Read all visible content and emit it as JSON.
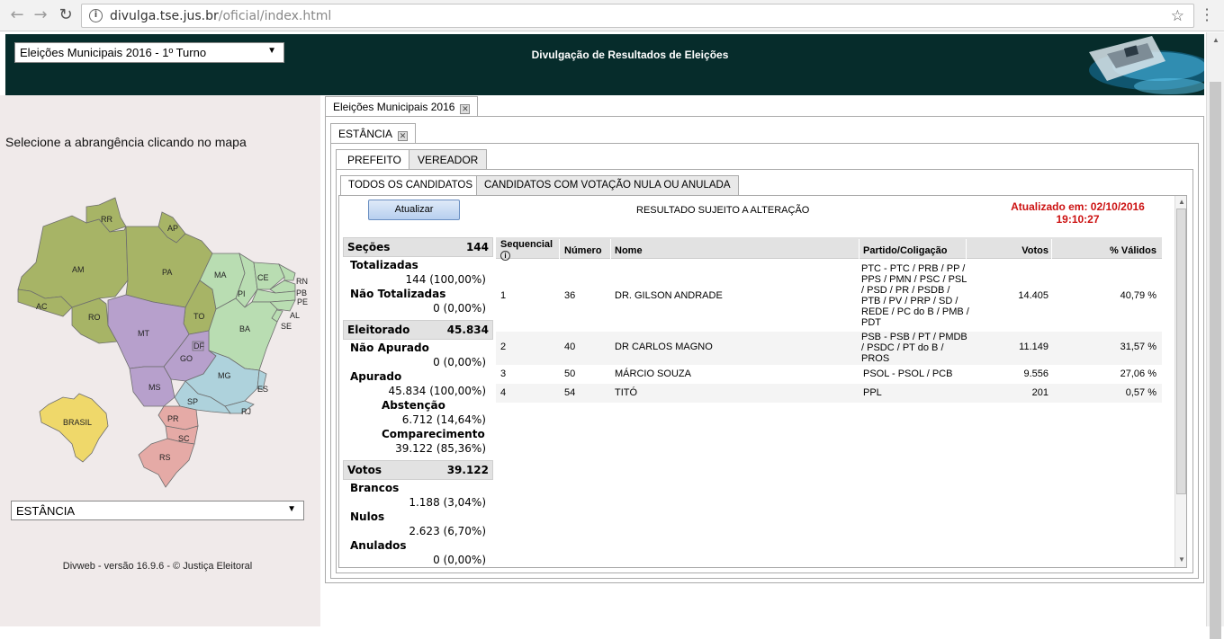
{
  "browser": {
    "url_host": "divulga.tse.jus.br",
    "url_path": "/oficial/index.html"
  },
  "header": {
    "election_select": "Eleições Municipais 2016 - 1º Turno",
    "title": "Divulgação de Resultados de Eleições"
  },
  "left": {
    "prompt": "Selecione a abrangência clicando no mapa",
    "map_labels": [
      "RR",
      "AP",
      "AM",
      "PA",
      "MA",
      "CE",
      "RN",
      "PB",
      "PE",
      "AL",
      "SE",
      "PI",
      "AC",
      "RO",
      "TO",
      "BA",
      "MT",
      "DF",
      "GO",
      "MG",
      "ES",
      "MS",
      "SP",
      "RJ",
      "PR",
      "SC",
      "RS",
      "BRASIL"
    ],
    "city_select": "ESTÂNCIA",
    "footer": "Divweb - versão 16.9.6 - © Justiça Eleitoral"
  },
  "tabs": {
    "election_tab": "Eleições Municipais 2016",
    "city_tab": "ESTÂNCIA",
    "office_tabs": [
      "PREFEITO",
      "VEREADOR"
    ],
    "cand_tabs": [
      "TODOS OS CANDIDATOS",
      "CANDIDATOS COM VOTAÇÃO NULA OU ANULADA"
    ]
  },
  "toolbar": {
    "refresh_label": "Atualizar",
    "note": "RESULTADO SUJEITO A ALTERAÇÃO",
    "updated_line1": "Atualizado em: 02/10/2016",
    "updated_line2": "19:10:27"
  },
  "stats": {
    "secoes": {
      "label": "Seções",
      "value": "144"
    },
    "totalizadas": {
      "label": "Totalizadas",
      "value": "144 (100,00%)"
    },
    "nao_totalizadas": {
      "label": "Não Totalizadas",
      "value": "0 (0,00%)"
    },
    "eleitorado": {
      "label": "Eleitorado",
      "value": "45.834"
    },
    "nao_apurado": {
      "label": "Não Apurado",
      "value": "0 (0,00%)"
    },
    "apurado": {
      "label": "Apurado",
      "value": "45.834 (100,00%)"
    },
    "abstencao": {
      "label": "Abstenção",
      "value": "6.712 (14,64%)"
    },
    "comparecimento": {
      "label": "Comparecimento",
      "value": "39.122 (85,36%)"
    },
    "votos": {
      "label": "Votos",
      "value": "39.122"
    },
    "brancos": {
      "label": "Brancos",
      "value": "1.188 (3,04%)"
    },
    "nulos": {
      "label": "Nulos",
      "value": "2.623 (6,70%)"
    },
    "anulados": {
      "label": "Anulados",
      "value": "0 (0,00%)"
    }
  },
  "table": {
    "headers": {
      "seq": "Sequencial",
      "numero": "Número",
      "nome": "Nome",
      "partido": "Partido/Coligação",
      "votos": "Votos",
      "validos": "% Válidos"
    },
    "rows": [
      {
        "seq": "1",
        "numero": "36",
        "nome": "DR. GILSON ANDRADE",
        "partido": "PTC - PTC / PRB / PP / PPS / PMN / PSC / PSL / PSD / PR / PSDB / PTB / PV / PRP / SD / REDE / PC do B / PMB / PDT",
        "votos": "14.405",
        "validos": "40,79 %"
      },
      {
        "seq": "2",
        "numero": "40",
        "nome": "DR CARLOS MAGNO",
        "partido": "PSB - PSB / PT / PMDB / PSDC / PT do B / PROS",
        "votos": "11.149",
        "validos": "31,57 %"
      },
      {
        "seq": "3",
        "numero": "50",
        "nome": "MÁRCIO SOUZA",
        "partido": "PSOL - PSOL / PCB",
        "votos": "9.556",
        "validos": "27,06 %"
      },
      {
        "seq": "4",
        "numero": "54",
        "nome": "TITÓ",
        "partido": "PPL",
        "votos": "201",
        "validos": "0,57 %"
      }
    ]
  },
  "colors": {
    "header_bg": "#062c2b",
    "left_bg": "#f0eaea",
    "updated_red": "#cc1111",
    "region_north": "#a7b466",
    "region_northeast": "#b9ddb2",
    "region_centerwest": "#b7a0cc",
    "region_southeast": "#aed2dc",
    "region_south": "#e5aaa6",
    "brasil": "#efd86a"
  }
}
